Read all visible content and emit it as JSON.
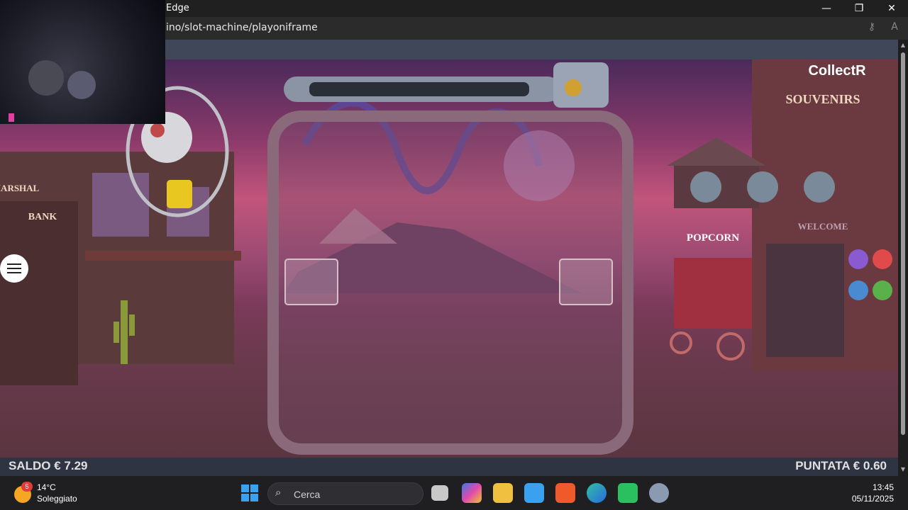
{
  "window": {
    "title": "Edge",
    "minimize_glyph": "—",
    "restore_glyph": "❐",
    "close_glyph": "✕"
  },
  "address_bar": {
    "url": "ino/slot-machine/playoniframe"
  },
  "game": {
    "logo": "CollectR",
    "signs": {
      "souvenirs": "SOUVENIRS",
      "bank": "BANK",
      "marshal": "MARSHAL",
      "popcorn": "POPCORN",
      "welcome": "WELCOME"
    },
    "saldo_label": "SALDO € 7.29",
    "puntata_label": "PUNTATA € 0.60"
  },
  "taskbar": {
    "weather_temp": "14°C",
    "weather_desc": "Soleggiato",
    "weather_badge": "5",
    "search_placeholder": "Cerca",
    "time": "13:45",
    "date": "05/11/2025",
    "apps": [
      "task-view-icon",
      "copilot-icon",
      "file-explorer-icon",
      "store-icon",
      "brave-icon",
      "edge-icon",
      "game-app-icon",
      "settings-icon"
    ]
  },
  "colors": {
    "sky_top": "#4a2a5a",
    "sky_mid": "#c2557a",
    "ground": "#5e3a44",
    "bottombar": "#2e3442",
    "start_blue": "#3aa0f0"
  }
}
